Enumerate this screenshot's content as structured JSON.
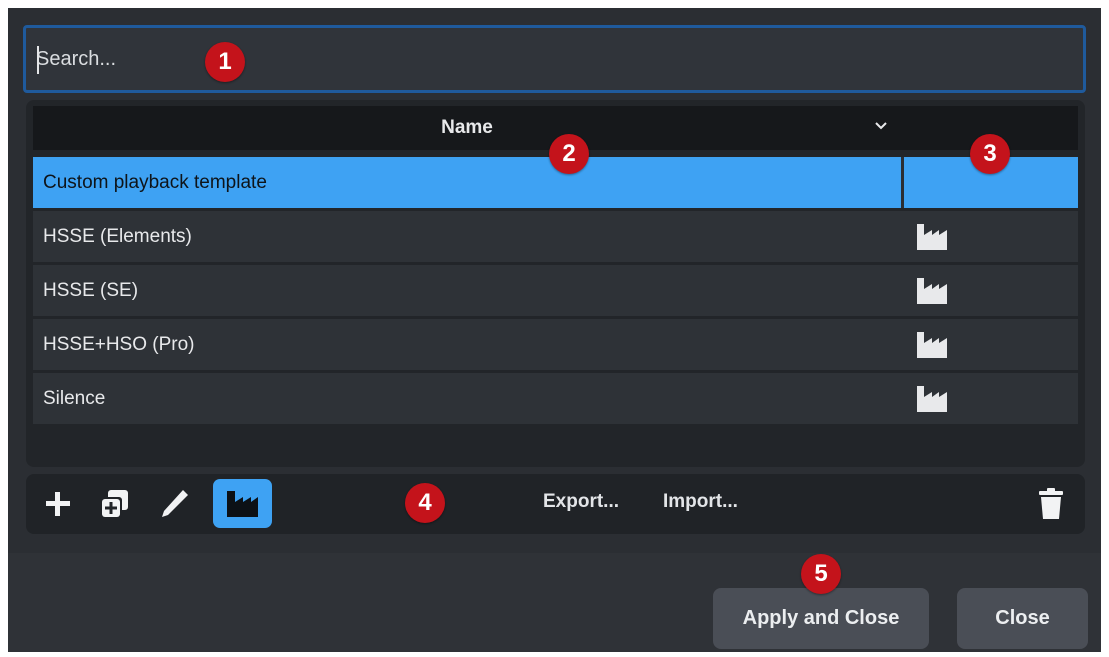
{
  "search": {
    "placeholder": "Search..."
  },
  "table": {
    "column_name": "Name",
    "rows": [
      {
        "name": "Custom playback template",
        "factory": false,
        "selected": true
      },
      {
        "name": "HSSE (Elements)",
        "factory": true,
        "selected": false
      },
      {
        "name": "HSSE (SE)",
        "factory": true,
        "selected": false
      },
      {
        "name": "HSSE+HSO (Pro)",
        "factory": true,
        "selected": false
      },
      {
        "name": "Silence",
        "factory": true,
        "selected": false
      }
    ]
  },
  "toolbar": {
    "icons": [
      "plus-icon",
      "duplicate-icon",
      "pencil-icon",
      "factory-icon",
      "trash-icon"
    ],
    "export_label": "Export...",
    "import_label": "Import..."
  },
  "footer": {
    "apply_label": "Apply and Close",
    "close_label": "Close"
  },
  "callouts": [
    "1",
    "2",
    "3",
    "4",
    "5"
  ],
  "colors": {
    "accent": "#3ea2f3",
    "callout": "#c4131b",
    "background": "#2b2e33"
  }
}
